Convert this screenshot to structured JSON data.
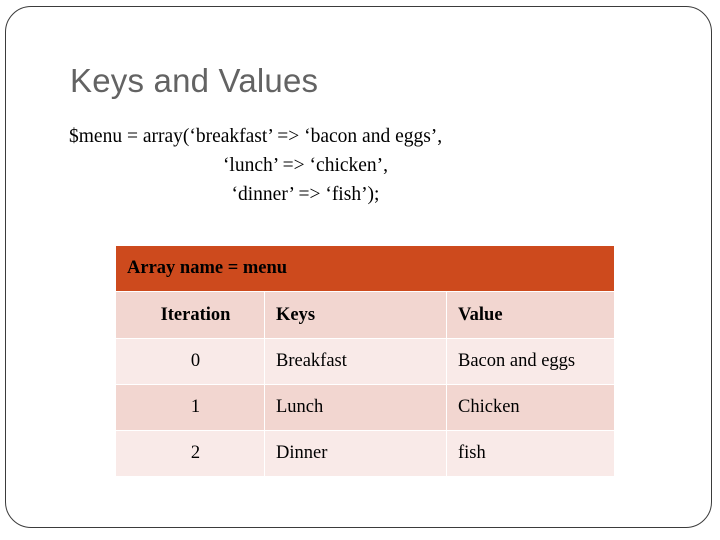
{
  "slide": {
    "title": "Keys and Values",
    "code": {
      "line1": "$menu = array(‘breakfast’ => ‘bacon and eggs’,",
      "line2": "‘lunch’ => ‘chicken’,",
      "line3": "‘dinner’ => ‘fish’);"
    },
    "table": {
      "caption": "Array name = menu",
      "columns": [
        "Iteration",
        "Keys",
        "Value"
      ],
      "rows": [
        {
          "iteration": "0",
          "key": "Breakfast",
          "value": "Bacon and eggs"
        },
        {
          "iteration": "1",
          "key": "Lunch",
          "value": "Chicken"
        },
        {
          "iteration": "2",
          "key": "Dinner",
          "value": "fish"
        }
      ]
    },
    "colors": {
      "caption_background": "#cd4a1d",
      "caption_text": "#fbf3ea",
      "header_background": "#f2d6d0",
      "row_light": "#f9eae8",
      "row_dark": "#f2d6d0",
      "title_text": "#636363",
      "frame_border": "#3b3b3b"
    }
  }
}
